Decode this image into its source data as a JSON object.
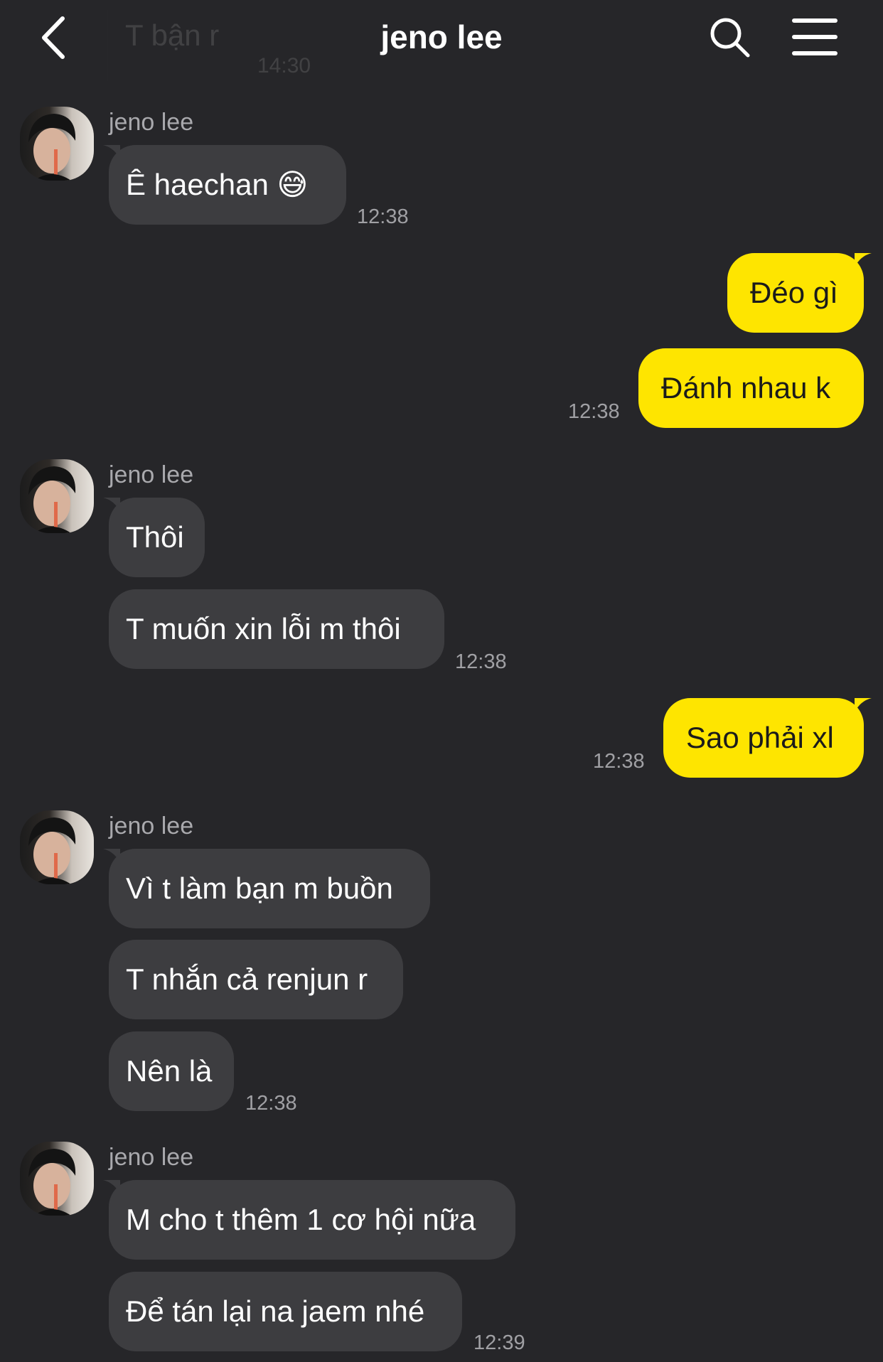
{
  "header": {
    "back_icon": "chevron-left-icon",
    "title": "jeno lee",
    "search_icon": "search-icon",
    "menu_icon": "hamburger-menu-icon",
    "ghost_preview_text": "T bận r",
    "ghost_preview_time": "14:30"
  },
  "colors": {
    "background": "#262629",
    "incoming_bubble": "#3d3d40",
    "outgoing_bubble": "#fee500",
    "timestamp": "#a0a0a4"
  },
  "messages": [
    {
      "sender": "jeno lee",
      "text": "Ê haechan 😅",
      "time": "12:38"
    },
    {
      "from": "me",
      "text": "Đéo gì"
    },
    {
      "from": "me",
      "text": "Đánh nhau k",
      "time": "12:38"
    },
    {
      "sender": "jeno lee",
      "text": "Thôi"
    },
    {
      "text": "T muốn xin lỗi m thôi",
      "time": "12:38"
    },
    {
      "from": "me",
      "text": "Sao phải xl",
      "time": "12:38"
    },
    {
      "sender": "jeno lee",
      "text": "Vì t làm bạn m buồn"
    },
    {
      "text": "T nhắn cả renjun r"
    },
    {
      "text": "Nên là",
      "time": "12:38"
    },
    {
      "sender": "jeno lee",
      "text": "M cho t thêm 1 cơ hội nữa"
    },
    {
      "text": "Để tán lại na jaem nhé",
      "time": "12:39"
    }
  ]
}
